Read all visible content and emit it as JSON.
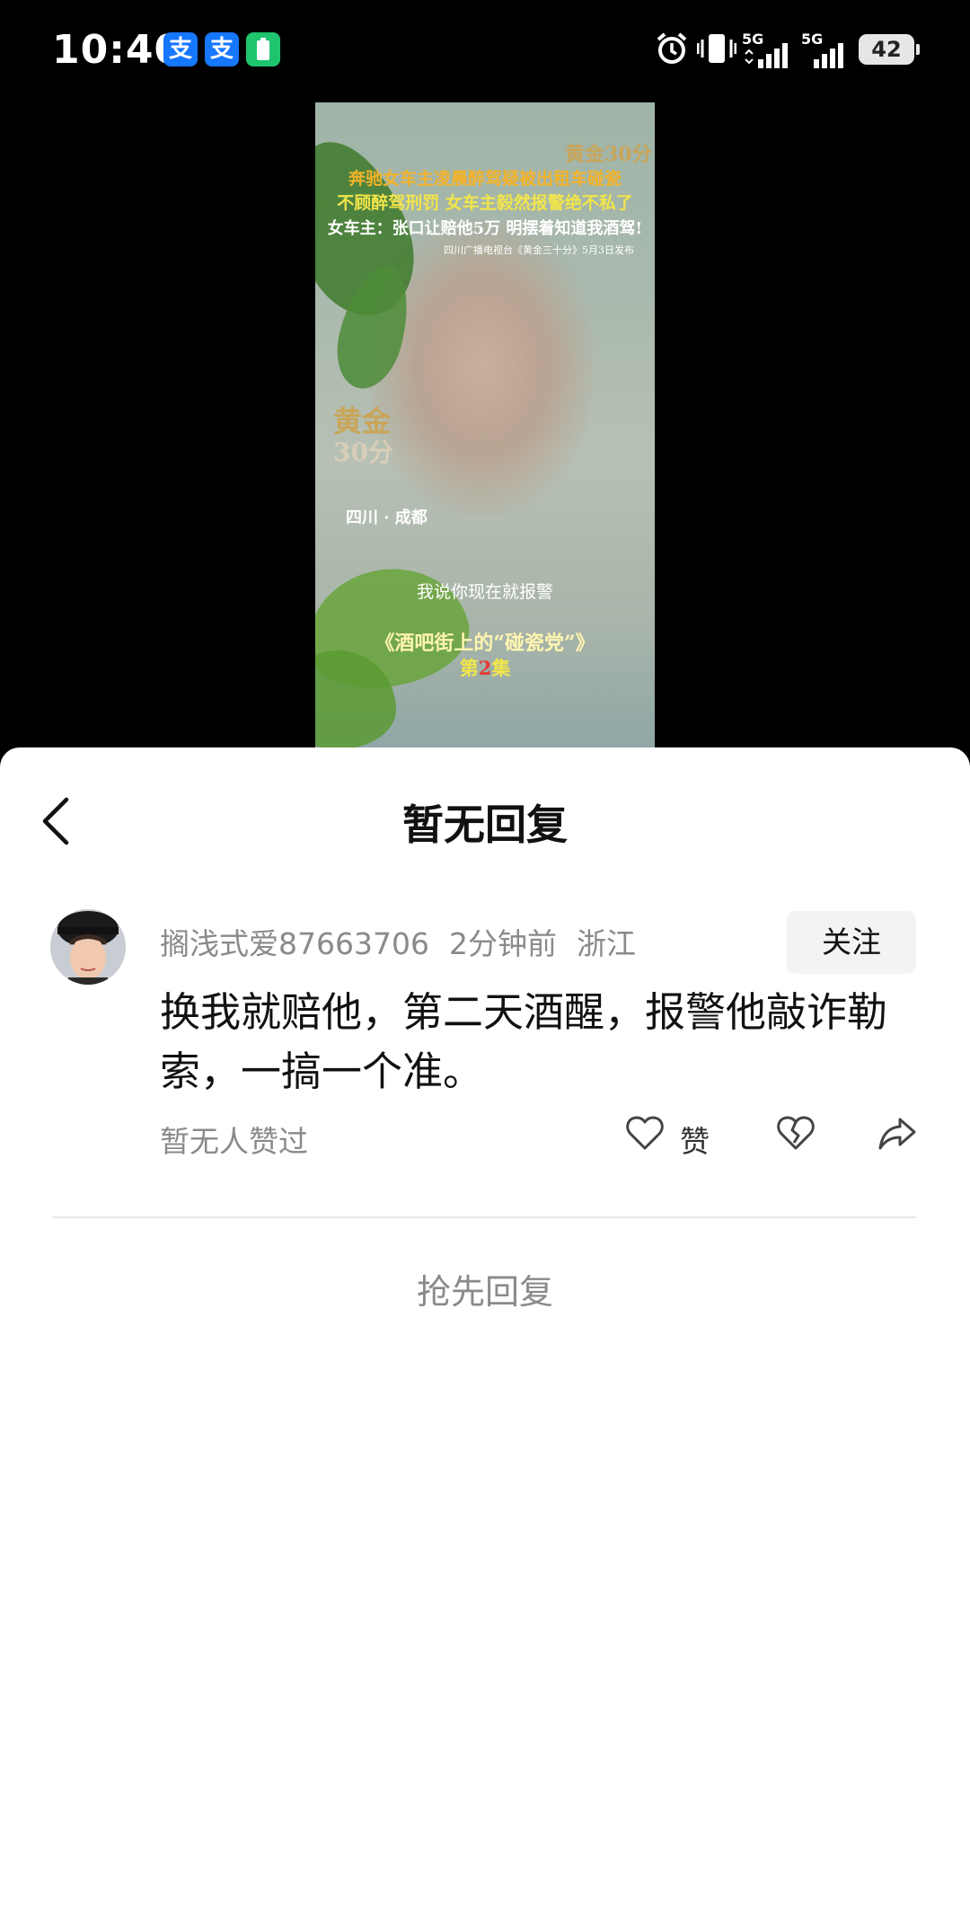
{
  "status_bar": {
    "time": "10:40",
    "app_icons": [
      "alipay-icon",
      "alipay-icon",
      "battery-app-icon"
    ],
    "app_icon_glyphs": [
      "支",
      "支",
      ""
    ],
    "network_1": "5G",
    "network_2": "5G",
    "battery": "42"
  },
  "video": {
    "headline_1": "奔驰女车主凌晨醉驾疑被出租车碰瓷",
    "headline_2": "不顾醉驾刑罚 女车主毅然报警绝不私了",
    "headline_3": "女车主：张口让赔他5万 明摆着知道我酒驾!",
    "source": "四川广播电视台《黄金三十分》5月3日发布",
    "logo_top": "黄金30分",
    "logo_big_1": "黄金",
    "logo_big_2": "30分",
    "location": "四川 · 成都",
    "subtitle": "我说你现在就报警",
    "series_title": "《酒吧街上的“碰瓷党”》",
    "episode_prefix": "第",
    "episode_num": "2",
    "episode_suffix": "集"
  },
  "sheet": {
    "title": "暂无回复",
    "comment": {
      "username": "搁浅式爱87663706",
      "time": "2分钟前",
      "location": "浙江",
      "follow_label": "关注",
      "text": "换我就赔他，第二天酒醒，报警他敲诈勒索，一搞一个准。",
      "likes_text": "暂无人赞过",
      "like_label": "赞"
    },
    "reply_prompt": "抢先回复"
  },
  "colors": {
    "alipay_blue": "#1677ff",
    "battery_app_green": "#1fc46e",
    "headline_orange": "#f4b32a",
    "headline_yellow": "#f2e54a"
  }
}
